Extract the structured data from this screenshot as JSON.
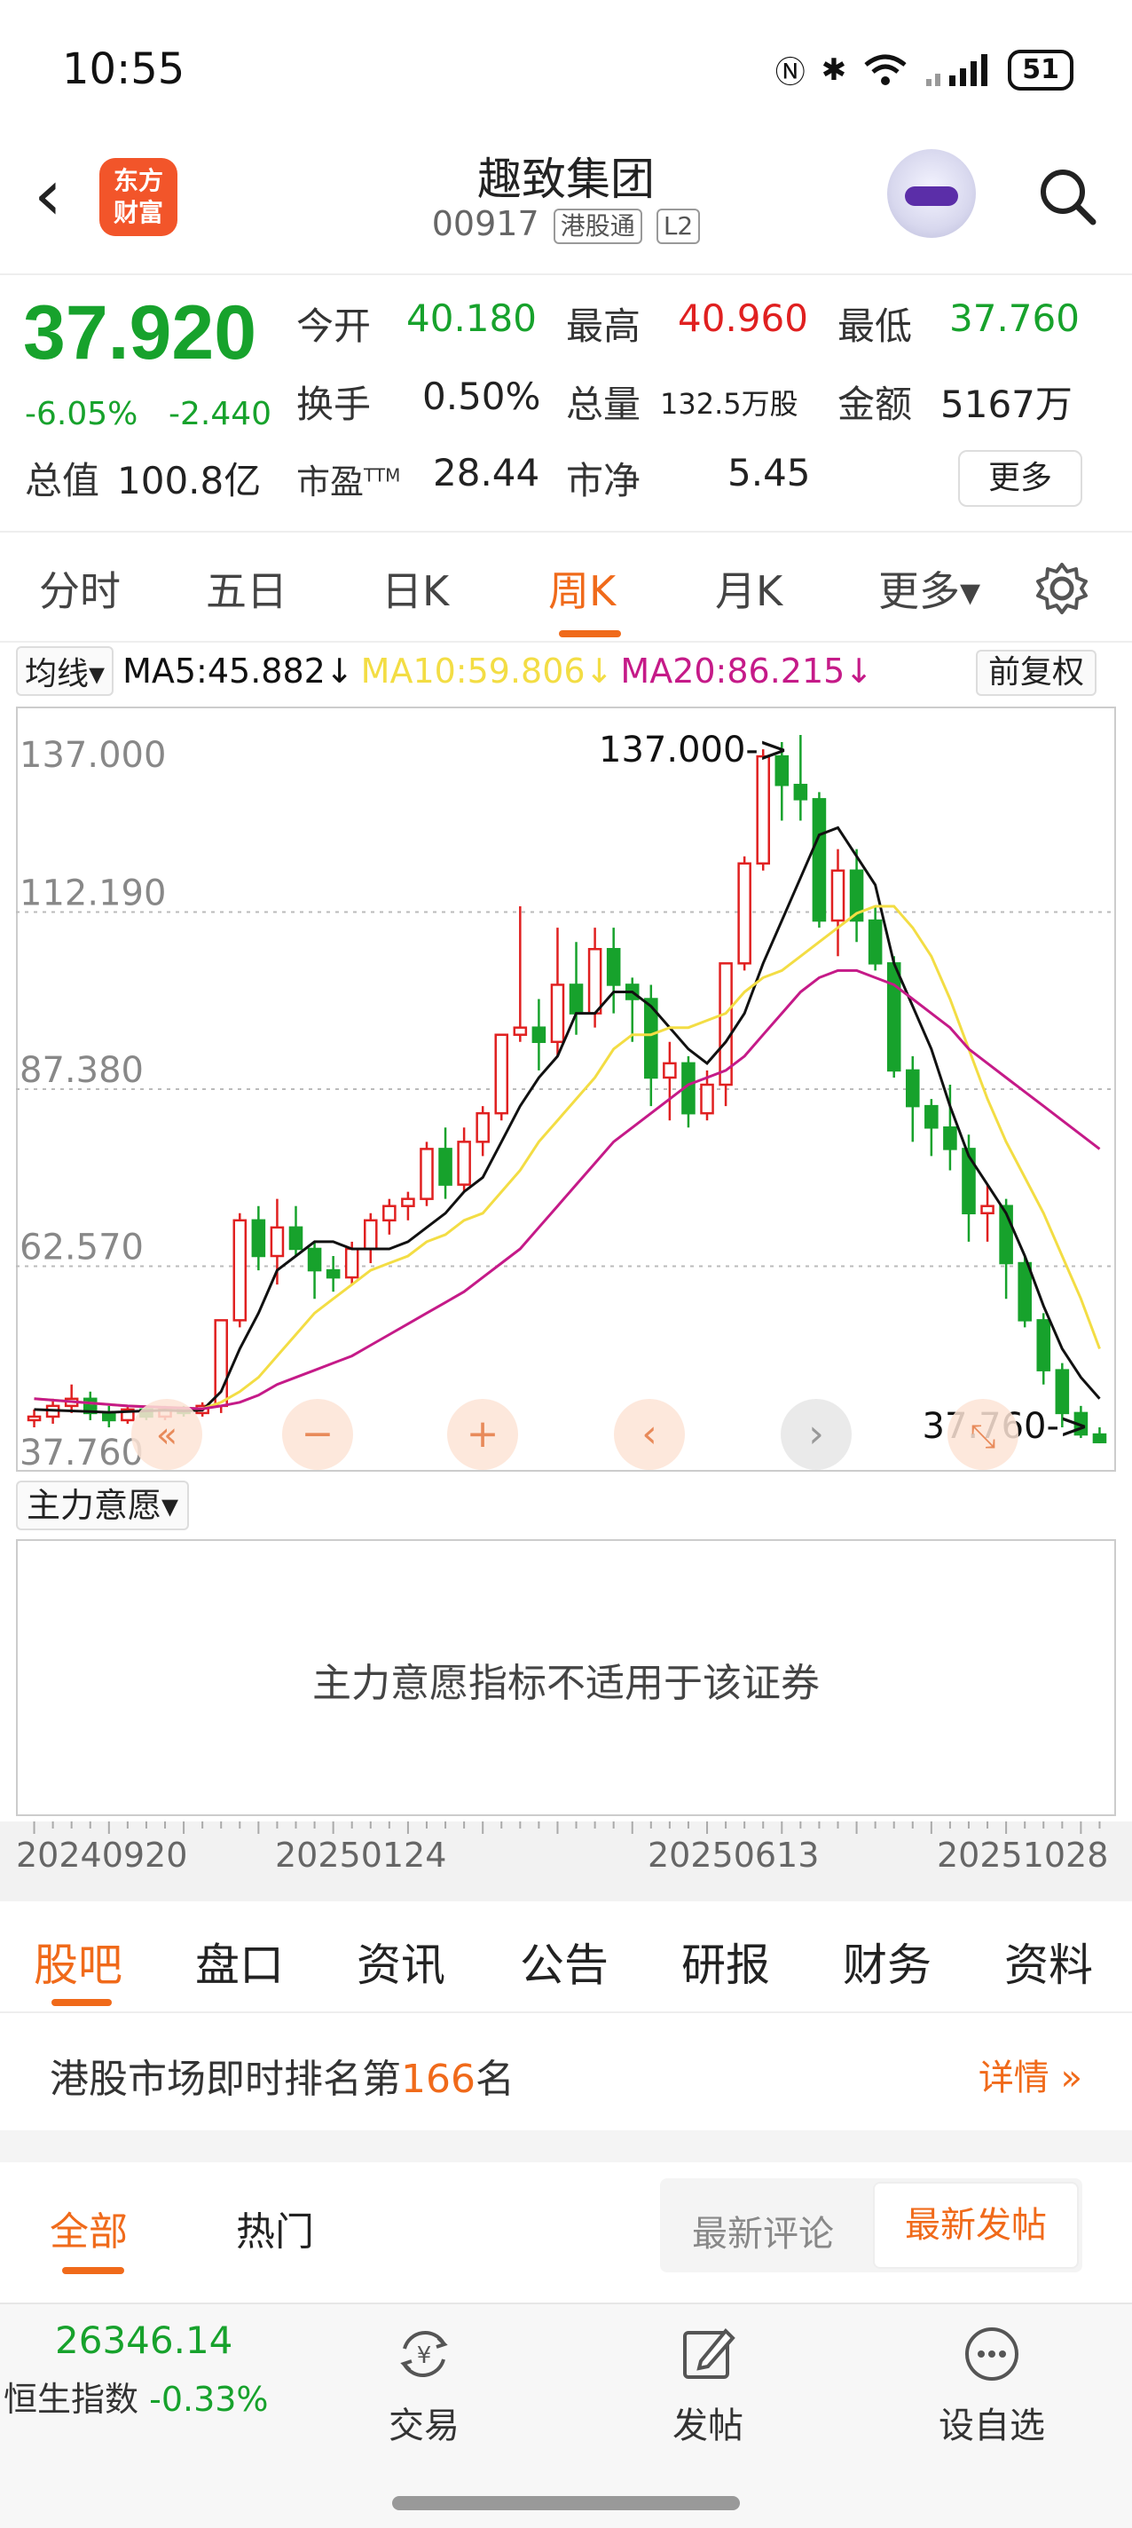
{
  "status_bar": {
    "time": "10:55",
    "battery": "51"
  },
  "header": {
    "logo_line1": "东方",
    "logo_line2": "财富",
    "stock_name": "趣致集团",
    "stock_code": "00917",
    "tag_connect": "港股通",
    "tag_level": "L2"
  },
  "quote": {
    "price": "37.920",
    "change_pct": "-6.05%",
    "change_abs": "-2.440",
    "open_label": "今开",
    "open": "40.180",
    "high_label": "最高",
    "high": "40.960",
    "low_label": "最低",
    "low": "37.760",
    "turnover_label": "换手",
    "turnover": "0.50%",
    "volume_label": "总量",
    "volume": "132.5万股",
    "amount_label": "金额",
    "amount": "5167万",
    "mcap_label": "总值",
    "mcap": "100.8亿",
    "pe_label": "市盈",
    "pe_sup": "TTM",
    "pe": "28.44",
    "pb_label": "市净",
    "pb": "5.45",
    "more_button": "更多"
  },
  "period_tabs": [
    "分时",
    "五日",
    "日K",
    "周K",
    "月K",
    "更多▾"
  ],
  "active_period": "周K",
  "ma_bar": {
    "selector": "均线▾",
    "ma5": "MA5:45.882↓",
    "ma10": "MA10:59.806↓",
    "ma20": "MA20:86.215↓",
    "adjust": "前复权"
  },
  "chart_data": {
    "type": "candlestick",
    "y_ticks": [
      "137.000",
      "112.190",
      "87.380",
      "62.570",
      "37.760"
    ],
    "ylim": [
      37.76,
      137.0
    ],
    "high_marker": "137.000->",
    "low_marker": "37.760->",
    "x_ticks": [
      "20240920",
      "20250124",
      "20250613",
      "20251028"
    ],
    "ohlc": [
      [
        41,
        42.5,
        40,
        41.5
      ],
      [
        41.5,
        44,
        40.5,
        43
      ],
      [
        43,
        46,
        42,
        44
      ],
      [
        44,
        45,
        41,
        42
      ],
      [
        42,
        43,
        40,
        41
      ],
      [
        41,
        43,
        40.5,
        42.5
      ],
      [
        42.5,
        43,
        41,
        41.5
      ],
      [
        41.5,
        43,
        41,
        42.5
      ],
      [
        42.5,
        43,
        41.5,
        42
      ],
      [
        42,
        43.5,
        41.5,
        43
      ],
      [
        43,
        55,
        42,
        55
      ],
      [
        55,
        70,
        54,
        69
      ],
      [
        69,
        71,
        62,
        64
      ],
      [
        64,
        72,
        60,
        68
      ],
      [
        68,
        71,
        64,
        65
      ],
      [
        65,
        66,
        58,
        62
      ],
      [
        62,
        64,
        59,
        61
      ],
      [
        61,
        66,
        60,
        65
      ],
      [
        65,
        70,
        63,
        69
      ],
      [
        69,
        72,
        67,
        71
      ],
      [
        71,
        73,
        69,
        72
      ],
      [
        72,
        80,
        71,
        79
      ],
      [
        79,
        82,
        72,
        74
      ],
      [
        74,
        82,
        73,
        80
      ],
      [
        80,
        85,
        78,
        84
      ],
      [
        84,
        95,
        83,
        95
      ],
      [
        95,
        113,
        94,
        96
      ],
      [
        96,
        100,
        90,
        94
      ],
      [
        94,
        110,
        92,
        102
      ],
      [
        102,
        108,
        95,
        98
      ],
      [
        98,
        110,
        96,
        107
      ],
      [
        107,
        110,
        98,
        102
      ],
      [
        102,
        103,
        94,
        100
      ],
      [
        100,
        102,
        85,
        89
      ],
      [
        89,
        94,
        83,
        91
      ],
      [
        91,
        92,
        82,
        84
      ],
      [
        84,
        90,
        83,
        88
      ],
      [
        88,
        105,
        85,
        105
      ],
      [
        105,
        120,
        104,
        119
      ],
      [
        119,
        135,
        118,
        134
      ],
      [
        134,
        136,
        125,
        130
      ],
      [
        130,
        137,
        125,
        128
      ],
      [
        128,
        129,
        110,
        111
      ],
      [
        111,
        121,
        106,
        118
      ],
      [
        118,
        121,
        108,
        111
      ],
      [
        111,
        113,
        104,
        105
      ],
      [
        105,
        106,
        89,
        90
      ],
      [
        90,
        92,
        80,
        85
      ],
      [
        85,
        86,
        78,
        82
      ],
      [
        82,
        88,
        76,
        79
      ],
      [
        79,
        81,
        66,
        70
      ],
      [
        70,
        74,
        66,
        71
      ],
      [
        71,
        72,
        58,
        63
      ],
      [
        63,
        64,
        54,
        55
      ],
      [
        55,
        56,
        46,
        48
      ],
      [
        48,
        49,
        40,
        42
      ],
      [
        42,
        43,
        38.5,
        39
      ],
      [
        39,
        40,
        37.76,
        37.92
      ]
    ],
    "series": [
      {
        "name": "MA5",
        "values": [
          42.5,
          42.4,
          42.3,
          42.2,
          42.1,
          42.2,
          42.3,
          42.4,
          42.3,
          42.4,
          45,
          51,
          56,
          62,
          64,
          66,
          66,
          65,
          65,
          65,
          66,
          68,
          70,
          73,
          75,
          80,
          85,
          89,
          92,
          98,
          98,
          101,
          101,
          99,
          96,
          93,
          91,
          94,
          98,
          105,
          111,
          117,
          123,
          124,
          120,
          116,
          105,
          99,
          93,
          85,
          78,
          74,
          70,
          64,
          57,
          51,
          47,
          44
        ]
      },
      {
        "name": "MA10",
        "values": [
          44,
          43.8,
          43.6,
          43.4,
          43.2,
          43,
          42.9,
          42.8,
          42.7,
          42.6,
          43.5,
          45,
          47,
          50,
          53,
          56,
          58,
          60,
          62,
          63,
          64,
          66,
          67,
          69,
          70,
          73,
          76,
          80,
          83,
          86,
          89,
          93,
          95,
          95,
          96,
          96,
          97,
          98,
          101,
          103,
          104,
          106,
          108,
          110,
          112,
          113,
          113,
          110,
          106,
          100,
          93,
          86,
          80,
          75,
          70,
          64,
          58,
          51
        ]
      },
      {
        "name": "MA20",
        "values": [
          44,
          43.8,
          43.6,
          43.4,
          43.2,
          43,
          42.9,
          42.8,
          42.7,
          42.6,
          43,
          43.5,
          44.5,
          46,
          47,
          48,
          49,
          50,
          51.5,
          53,
          54.5,
          56,
          57.5,
          59,
          61,
          63,
          65,
          68,
          71,
          74,
          77,
          80,
          82,
          84,
          86,
          88,
          89,
          90,
          92,
          95,
          98,
          101,
          103,
          104,
          104,
          103,
          102,
          100,
          98,
          96,
          93,
          91,
          89,
          87,
          85,
          83,
          81,
          79
        ]
      }
    ]
  },
  "indicator": {
    "selector": "主力意愿▾",
    "message": "主力意愿指标不适用于该证券"
  },
  "content_tabs": [
    "股吧",
    "盘口",
    "资讯",
    "公告",
    "研报",
    "财务",
    "资料"
  ],
  "rank": {
    "prefix": "港股市场即时排名第",
    "number": "166",
    "suffix": "名",
    "detail": "详情 »"
  },
  "feed_tabs": {
    "all": "全部",
    "hot": "热门",
    "latest_comment": "最新评论",
    "latest_post": "最新发帖"
  },
  "bottom_bar": {
    "index_value": "26346.14",
    "index_name": "恒生指数",
    "index_change": "-0.33%",
    "trade": "交易",
    "post": "发帖",
    "watchlist": "设自选"
  },
  "colors": {
    "up": "#e02020",
    "down": "#17a22c",
    "accent": "#f06a1a",
    "ma5": "#111111",
    "ma10": "#f3dd44",
    "ma20": "#c51a88"
  }
}
